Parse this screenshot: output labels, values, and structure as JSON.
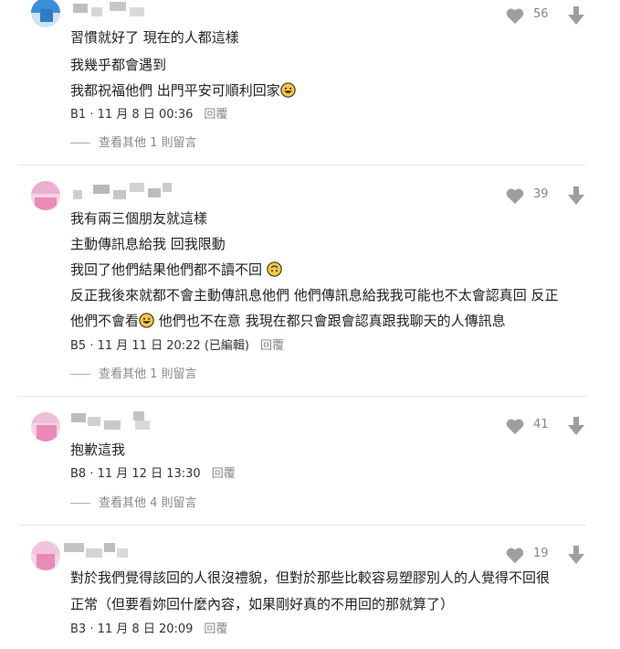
{
  "comments": [
    {
      "lines": [
        "習慣就好了 現在的人都這樣",
        "我幾乎都會遇到",
        "我都祝福他們 出門平安可順利回家"
      ],
      "emoji_line": 2,
      "emoji_name": "grinning-face-icon",
      "floor": "B1",
      "date": "11 月 8 日 00:36",
      "reply_label": "回覆",
      "likes": "56",
      "more_replies": "查看其他 1 則留言"
    },
    {
      "lines": [
        "我有兩三個朋友就這樣",
        "主動傳訊息給我 回我限動",
        "我回了他們結果他們都不讀不回",
        "反正我後來就都不會主動傳訊息他們 他們傳訊息給我我可能也不太會認真回 反正",
        "他們不會看",
        "他們也不在意 我現在都只會跟會認真跟我聊天的人傳訊息"
      ],
      "floor": "B5",
      "date": "11 月 11 日 20:22 (已編輯)",
      "reply_label": "回覆",
      "likes": "39",
      "more_replies": "查看其他 1 則留言"
    },
    {
      "lines": [
        "抱歉這我"
      ],
      "floor": "B8",
      "date": "11 月 12 日 13:30",
      "reply_label": "回覆",
      "likes": "41",
      "more_replies": "查看其他 4 則留言"
    },
    {
      "lines": [
        "對於我們覺得該回的人很沒禮貌，但對於那些比較容易塑膠別人的人覺得不回很",
        "正常（但要看妳回什麼內容，如果剛好真的不用回的那就算了）"
      ],
      "floor": "B3",
      "date": "11 月 8 日 20:09",
      "reply_label": "回覆",
      "likes": "19"
    }
  ],
  "colors": {
    "avatar_blue": "#3b8fd9",
    "avatar_pink": "#e98ab8",
    "emoji": "#f5c542"
  },
  "icons": [
    "thumbs-up-icon",
    "thumbs-down-icon",
    "grinning-face-icon",
    "upside-down-face-icon"
  ]
}
